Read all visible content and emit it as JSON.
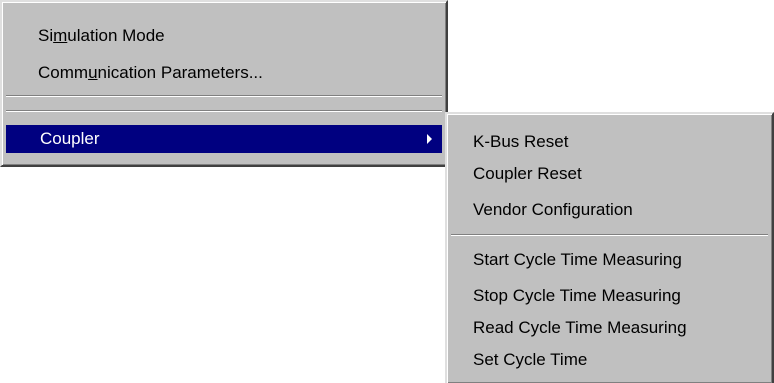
{
  "main_menu": {
    "items": [
      {
        "pre": "Si",
        "acc": "m",
        "post": "ulation Mode"
      },
      {
        "pre": "Comm",
        "acc": "u",
        "post": "nication Parameters..."
      }
    ],
    "coupler": {
      "label": "Coupler"
    }
  },
  "submenu": {
    "group1": [
      "K-Bus Reset",
      "Coupler Reset",
      "Vendor Configuration"
    ],
    "group2": [
      "Start Cycle Time Measuring",
      "Stop Cycle Time Measuring",
      "Read Cycle Time Measuring",
      "Set Cycle Time"
    ]
  },
  "colors": {
    "highlight": "#000080",
    "menu_bg": "#c0c0c0"
  }
}
